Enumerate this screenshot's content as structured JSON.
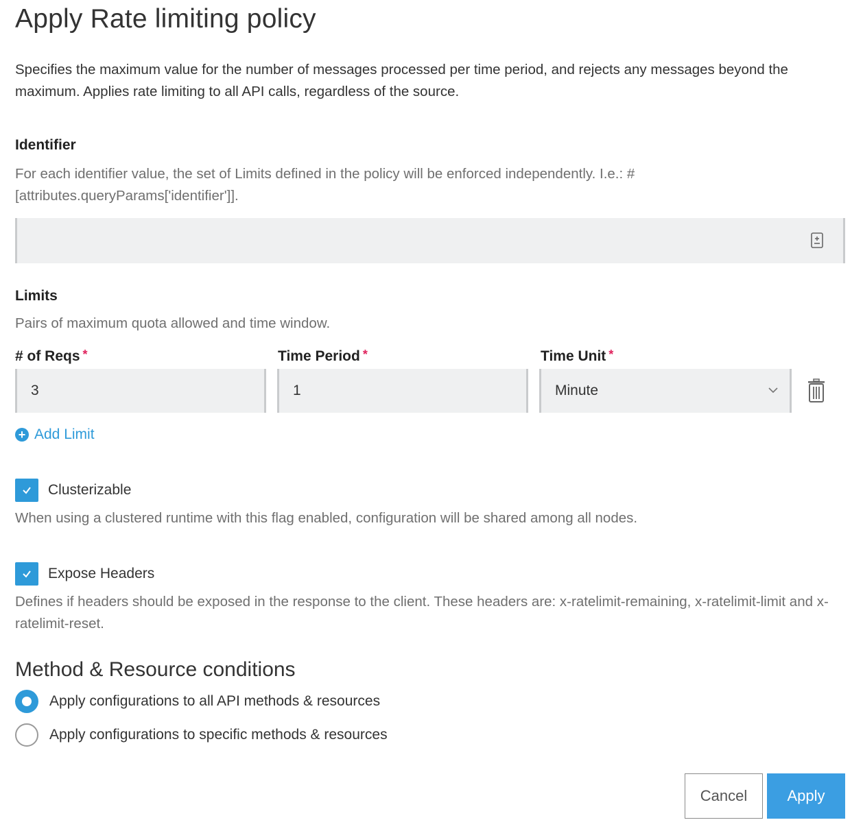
{
  "dialog": {
    "title": "Apply Rate limiting policy",
    "description": "Specifies the maximum value for the number of messages processed per time period, and rejects any messages beyond the maximum. Applies rate limiting to all API calls, regardless of the source."
  },
  "identifier": {
    "label": "Identifier",
    "help": "For each identifier value, the set of Limits defined in the policy will be enforced independently. I.e.: #[attributes.queryParams['identifier']].",
    "value": ""
  },
  "limits": {
    "label": "Limits",
    "help": "Pairs of maximum quota allowed and time window.",
    "columns": {
      "reqs_label": "# of Reqs",
      "period_label": "Time Period",
      "unit_label": "Time Unit",
      "required_mark": "*"
    },
    "rows": [
      {
        "reqs": "3",
        "period": "1",
        "unit": "Minute"
      }
    ],
    "add_label": "Add Limit"
  },
  "clusterizable": {
    "label": "Clusterizable",
    "checked": true,
    "help": "When using a clustered runtime with this flag enabled, configuration will be shared among all nodes."
  },
  "expose_headers": {
    "label": "Expose Headers",
    "checked": true,
    "help": "Defines if headers should be exposed in the response to the client. These headers are: x-ratelimit-remaining, x-ratelimit-limit and x-ratelimit-reset."
  },
  "conditions": {
    "heading": "Method & Resource conditions",
    "options": [
      {
        "label": "Apply configurations to all API methods & resources",
        "selected": true
      },
      {
        "label": "Apply configurations to specific methods & resources",
        "selected": false
      }
    ]
  },
  "footer": {
    "cancel_label": "Cancel",
    "apply_label": "Apply"
  },
  "colors": {
    "accent": "#2e9ad9",
    "required": "#e0245e",
    "field_bg": "#eff0f1"
  }
}
